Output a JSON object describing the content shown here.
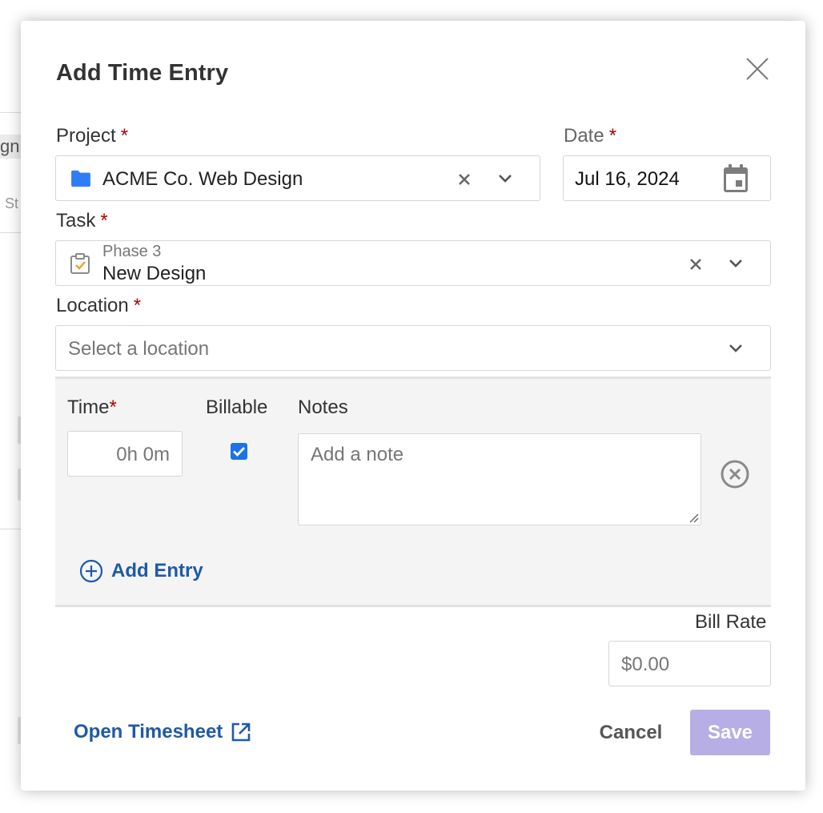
{
  "background": {
    "fragment_text_1": "gn",
    "fragment_text_2": "St"
  },
  "modal": {
    "title": "Add Time Entry",
    "close_icon": "close-icon"
  },
  "project": {
    "label": "Project",
    "required_mark": "*",
    "value": "ACME Co. Web Design",
    "icon": "folder-icon",
    "folder_color": "#2f7df6"
  },
  "date": {
    "label": "Date",
    "required_mark": "*",
    "value": "Jul 16, 2024",
    "icon": "calendar-icon"
  },
  "task": {
    "label": "Task",
    "required_mark": "*",
    "phase": "Phase 3",
    "value": "New Design",
    "icon": "task-clipboard-icon"
  },
  "location": {
    "label": "Location",
    "required_mark": "*",
    "placeholder": "Select a location"
  },
  "entry": {
    "time_label": "Time",
    "time_required_mark": "*",
    "time_value": "0h 0m",
    "billable_label": "Billable",
    "billable_checked": true,
    "notes_label": "Notes",
    "notes_placeholder": "Add a note",
    "add_entry_label": "Add Entry"
  },
  "bill_rate": {
    "label": "Bill Rate",
    "placeholder": "$0.00"
  },
  "footer": {
    "open_timesheet_label": "Open Timesheet",
    "cancel_label": "Cancel",
    "save_label": "Save"
  },
  "colors": {
    "accent_link": "#1f5aa6",
    "required": "#b00000",
    "save_disabled": "#b8aee6",
    "checkbox": "#1a73e8"
  }
}
